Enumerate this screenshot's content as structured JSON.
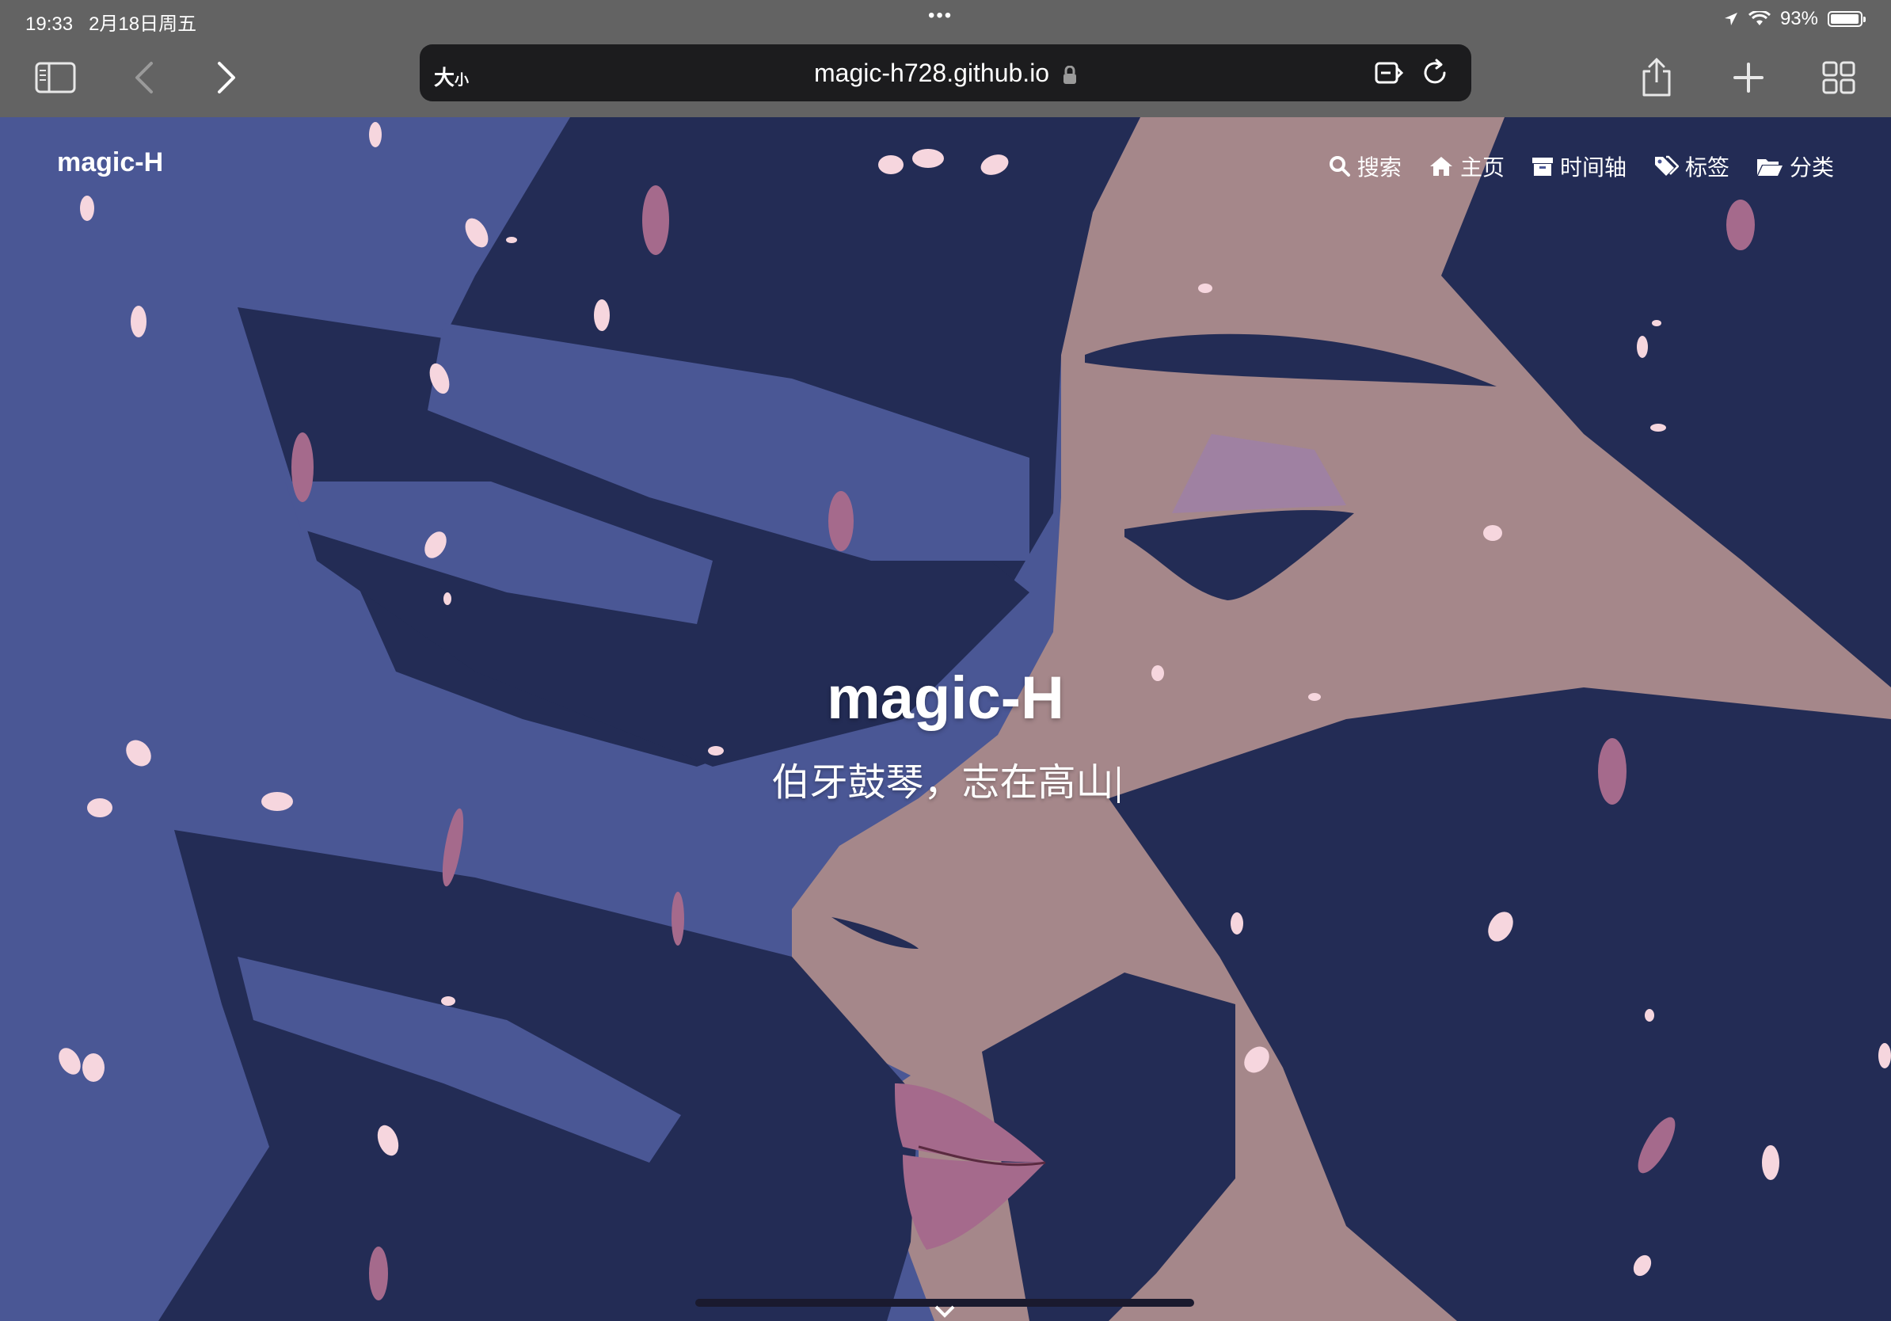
{
  "status": {
    "time": "19:33",
    "date": "2月18日周五",
    "battery": "93%",
    "battery_level": 0.93
  },
  "browser": {
    "text_size_label": "大",
    "text_size_small": "小",
    "url": "magic-h728.github.io",
    "icons": [
      "sidebar-icon",
      "back-icon",
      "forward-icon",
      "lock-icon",
      "reader-icon",
      "reload-icon",
      "share-icon",
      "new-tab-icon",
      "tabs-icon"
    ]
  },
  "site": {
    "brand": "magic-H",
    "nav": [
      {
        "label": "搜索",
        "icon": "search-icon"
      },
      {
        "label": "主页",
        "icon": "home-icon"
      },
      {
        "label": "时间轴",
        "icon": "archive-icon"
      },
      {
        "label": "标签",
        "icon": "tags-icon"
      },
      {
        "label": "分类",
        "icon": "folder-icon"
      }
    ],
    "hero_title": "magic-H",
    "hero_subtitle": "伯牙鼓琴，志在高山"
  },
  "colors": {
    "bg_blue": "#4a5795",
    "dark_navy": "#232c55",
    "skin": "#a5878a",
    "petal": "#f6d6de",
    "lip": "#a56a8c",
    "browser_chrome": "#636363"
  }
}
